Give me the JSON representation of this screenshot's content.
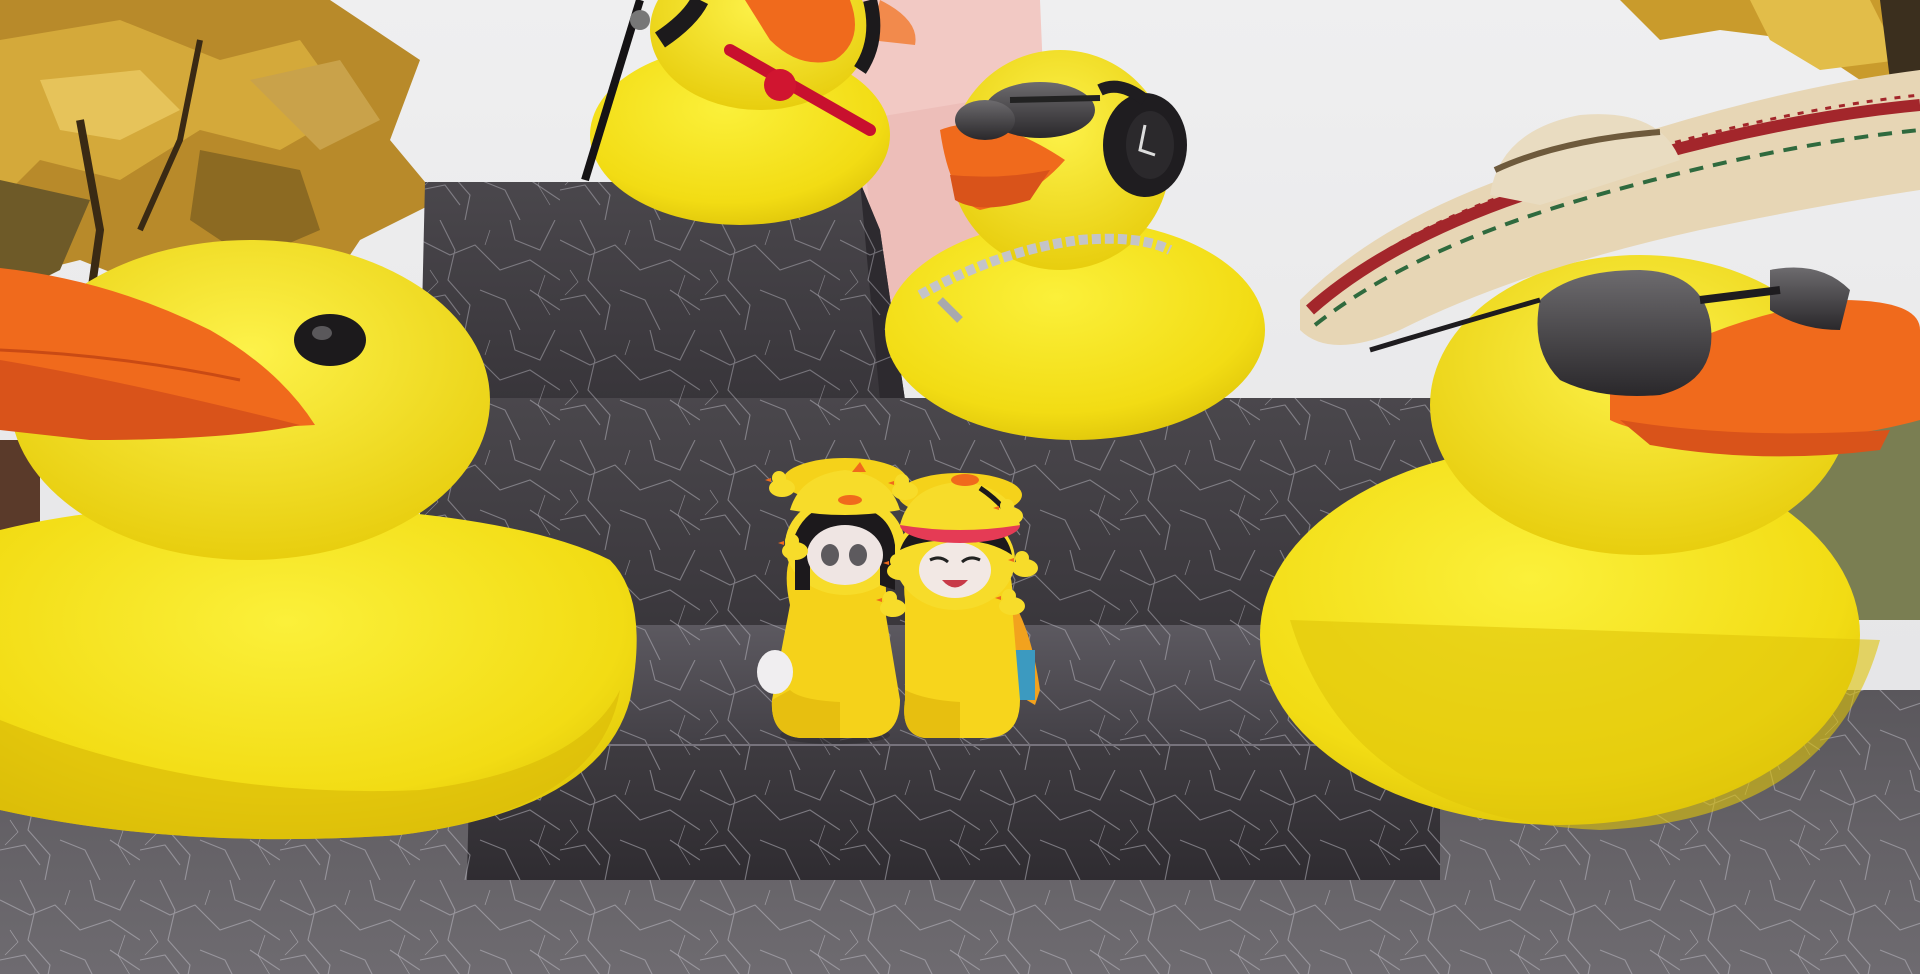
{
  "game": {
    "engine_style": "Roblox",
    "scene": "duck-statue-podium",
    "hud_text": []
  },
  "colors": {
    "sky": "#e9e9ea",
    "duck_yellow": "#f5e11a",
    "duck_shadow": "#e0c40a",
    "beak_orange": "#f06a1c",
    "beak_dark": "#d9531a",
    "marble_dark": "#3d3a3e",
    "marble_light": "#6d6a70",
    "marble_vein": "#b9b6c0",
    "foliage_gold": "#c99a2a",
    "foliage_dark": "#6b4e1c",
    "pink_block": "#f2c9c4",
    "hat_straw": "#e7d6b5",
    "hat_band_red": "#a3262b"
  },
  "objects": [
    {
      "name": "giant-duck-left",
      "accessory": "none"
    },
    {
      "name": "giant-duck-top-left",
      "accessory": "red-headphones"
    },
    {
      "name": "giant-duck-top-center",
      "accessory": "sunglasses-headphones-chain"
    },
    {
      "name": "giant-duck-right",
      "accessory": "sombrero-sunglasses"
    },
    {
      "name": "player-avatar-left",
      "outfit": "duck-costume"
    },
    {
      "name": "player-avatar-right",
      "outfit": "duck-costume"
    }
  ]
}
